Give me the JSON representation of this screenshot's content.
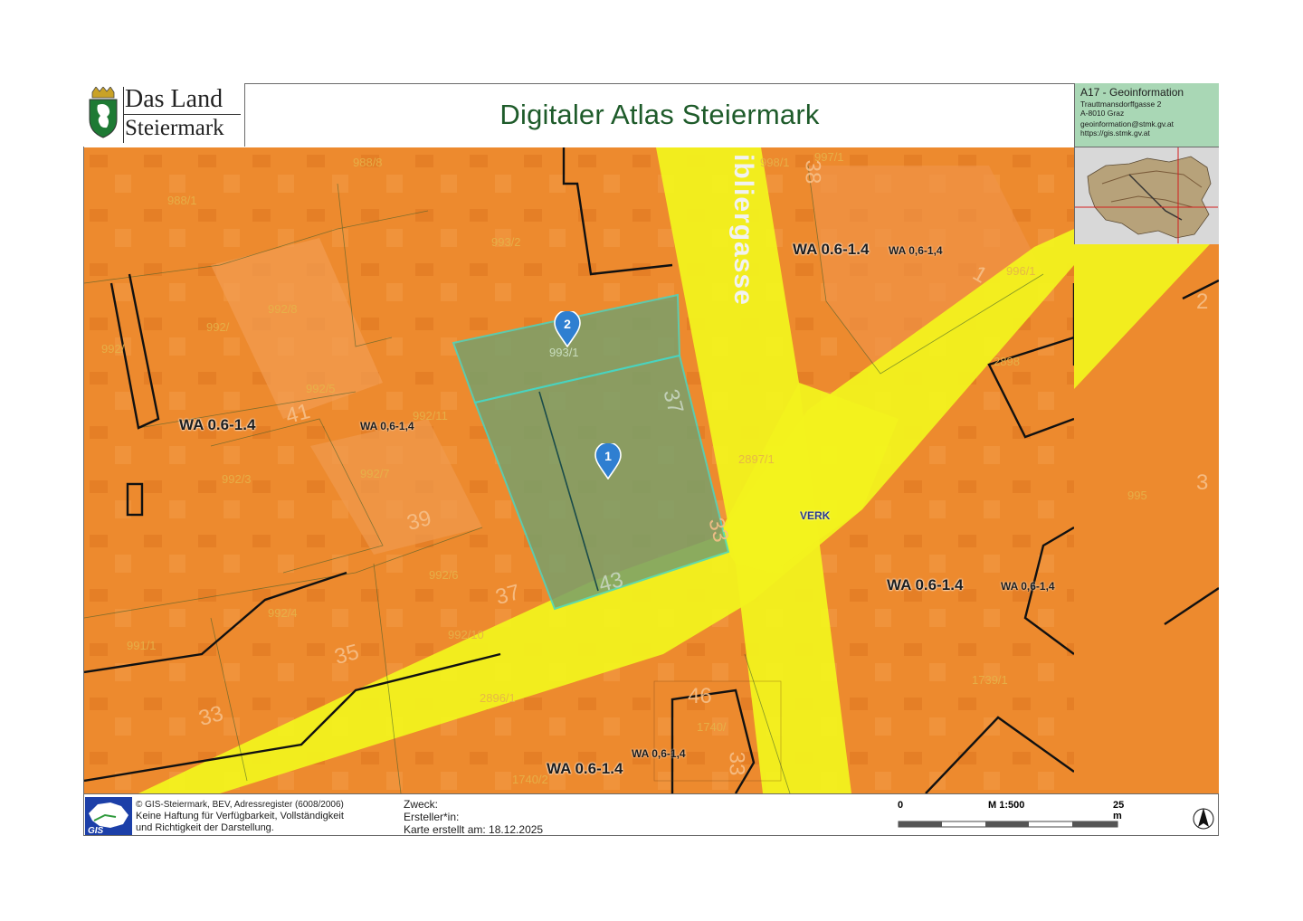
{
  "header": {
    "logo_line1": "Das Land",
    "logo_line2": "Steiermark",
    "title": "Digitaler Atlas Steiermark",
    "info": {
      "title": "A17 - Geoinformation",
      "lines": [
        "Trauttmansdorffgasse 2",
        "A-8010 Graz",
        "geoinformation@stmk.gv.at",
        "https://gis.stmk.gv.at"
      ]
    }
  },
  "map": {
    "street_name": "ibliergasse",
    "verk_label": "VERK",
    "zoning_labels": [
      {
        "big": "WA 0.6-1.4",
        "small": ""
      },
      {
        "big": "WA 0.6-1.4",
        "small": "WA 0,6-1,4"
      },
      {
        "big": "WA 0.6-1.4",
        "small": "WA 0,6-1,4"
      },
      {
        "big": "WA 0.6-1.4",
        "small": "WA 0,6-1,4"
      },
      {
        "big": "",
        "small": "WA 0,6-1,4"
      }
    ],
    "parcels": [
      "988/8",
      "988/1",
      "993/2",
      "992/8",
      "992/",
      "992/",
      "993/1",
      "992/5",
      "992/11",
      "992/3",
      "992/7",
      "992/6",
      "992/4",
      "991/1",
      "992/10",
      "2896/1",
      "1740/",
      "1740/2",
      "998/1",
      "997/1",
      "996/1",
      "2898",
      "2897/1",
      "1739/1",
      "995"
    ],
    "house_numbers": [
      "38",
      "41",
      "39",
      "37",
      "43",
      "37",
      "35",
      "33",
      "33",
      "46",
      "33",
      "1",
      "2",
      "3"
    ],
    "markers": [
      "1",
      "2"
    ],
    "colors": {
      "zoning": "#ed8a2e",
      "road": "#f2f21d",
      "selection": "#7aa06a",
      "selection_border": "#45d6c4"
    }
  },
  "footer": {
    "copyright": "© GIS-Steiermark, BEV, Adressregister (6008/2006)",
    "disclaimer_line2": "Keine Haftung für Verfügbarkeit, Vollständigkeit",
    "disclaimer_line3": "und Richtigkeit der Darstellung.",
    "purpose_label": "Zweck:",
    "creator_label": "Ersteller*in:",
    "created": "Karte erstellt am: 18.12.2025",
    "scale_start": "0",
    "scale_ratio": "M 1:500",
    "scale_end": "25 m",
    "gis_logo_text": "GIS"
  }
}
